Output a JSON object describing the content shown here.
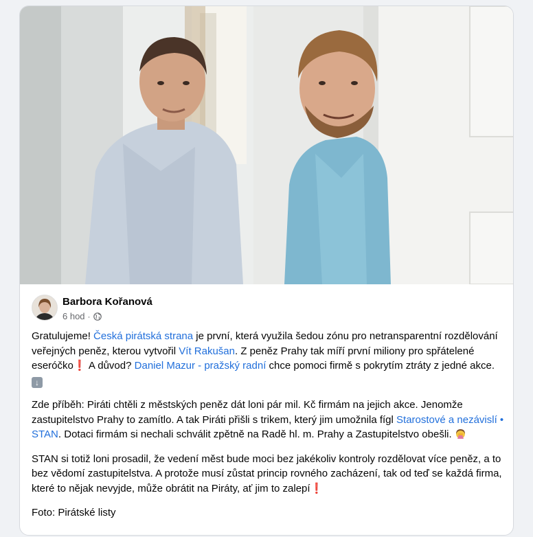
{
  "post": {
    "author_name": "Barbora Kořanová",
    "time": "6 hod",
    "separator": "·",
    "icons": {
      "privacy": "globe-icon",
      "exclamation": "red-exclamation-icon",
      "down_arrow": "down-arrow-icon",
      "facepalm": "woman-facepalming-icon"
    },
    "paragraph1": {
      "t1": "Gratulujeme! ",
      "link1": "Česká pirátská strana",
      "t2": " je první, která využila šedou zónu pro netransparentní rozdělování veřejných peněz, kterou vytvořil ",
      "link2": "Vít Rakušan",
      "t3": ". Z peněz Prahy tak míří první miliony pro spřátelené eseróčko",
      "t4": " A důvod? ",
      "link3": "Daniel Mazur - pražský radní",
      "t5": " chce pomoci firmě s pokrytím ztráty z jedné akce. "
    },
    "paragraph2": {
      "t1": "Zde příběh: Piráti chtěli z městských peněz dát loni pár mil. Kč firmám na jejich akce. Jenomže zastupitelstvo Prahy to zamítlo. A tak Piráti přišli s trikem, který jim umožnila fígl ",
      "link1": "Starostové a nezávislí • STAN",
      "t2": ". Dotaci firmám si nechali schválit zpětně na Radě hl. m. Prahy a Zastupitelstvo obešli. "
    },
    "paragraph3": {
      "t1": "STAN si totiž loni prosadil, že vedení měst bude moci bez jakékoliv kontroly rozdělovat více peněz, a to bez vědomí zastupitelstva. A protože musí zůstat princip rovného zacházení, tak od teď se každá firma, které to nějak nevyjde, může obrátit na Piráty, ať jim to zalepí"
    },
    "caption": "Foto: Pirátské listy",
    "colors": {
      "link": "#216fdb",
      "text": "#050505",
      "meta": "#65676b",
      "card_bg": "#ffffff",
      "page_bg": "#f0f2f5"
    }
  }
}
